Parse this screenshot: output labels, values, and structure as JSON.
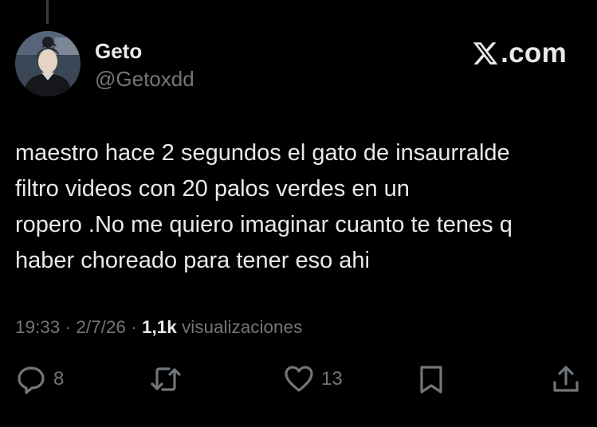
{
  "author": {
    "display_name": "Geto",
    "handle": "@Getoxdd"
  },
  "brand": {
    "text": ".com"
  },
  "tweet": {
    "lines": [
      "maestro hace 2 segundos el gato de insaurralde",
      "filtro videos con 20 palos verdes en un",
      "ropero .No me quiero imaginar cuanto te tenes q",
      "haber choreado para tener eso ahi"
    ]
  },
  "meta": {
    "time": "19:33",
    "separator": "·",
    "date": "2/7/26",
    "views_count": "1,1k",
    "views_label": "visualizaciones"
  },
  "actions": {
    "reply_count": "8",
    "like_count": "13"
  },
  "icons": {
    "reply": "reply-icon",
    "retweet": "retweet-icon",
    "like": "heart-icon",
    "bookmark": "bookmark-icon",
    "share": "share-icon",
    "brand": "x-logo-icon"
  },
  "colors": {
    "background": "#000000",
    "text_primary": "#e7e9ea",
    "text_secondary": "#71767b"
  }
}
